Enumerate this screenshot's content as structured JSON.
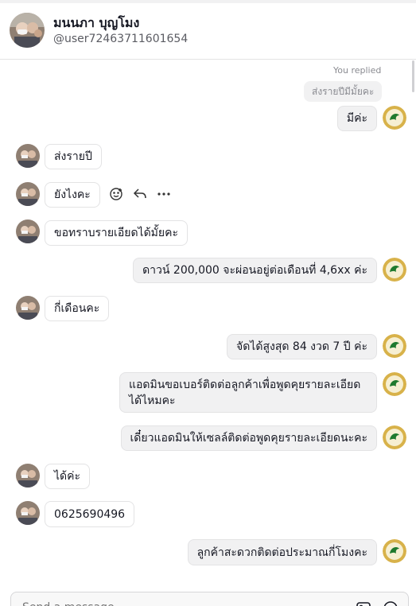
{
  "header": {
    "name": "มนนภา บุญโมง",
    "handle": "@user72463711601654"
  },
  "reply_context": {
    "label": "You replied",
    "quoted_text": "ส่งรายปีมีมั้ยคะ"
  },
  "messages": [
    {
      "from": "me",
      "text": "มีค่ะ"
    },
    {
      "from": "them",
      "text": "ส่งรายปี"
    },
    {
      "from": "them",
      "text": "ยังไงคะ"
    },
    {
      "from": "them",
      "text": "ขอทราบรายเอียดได้มั้ยคะ"
    },
    {
      "from": "me",
      "text": "ดาวน์ 200,000 จะผ่อนอยู่ต่อเดือนที่ 4,6xx ค่ะ"
    },
    {
      "from": "them",
      "text": "กี่เดือนคะ"
    },
    {
      "from": "me",
      "text": "จัดได้สูงสุด 84 งวด 7 ปี ค่ะ"
    },
    {
      "from": "me",
      "text": "แอดมินขอเบอร์ติดต่อลูกค้าเพื่อพูดคุยรายละเอียดได้ไหมคะ"
    },
    {
      "from": "me",
      "text": "เดี๋ยวแอดมินให้เซลล์ติดต่อพูดคุยรายละเอียดนะคะ"
    },
    {
      "from": "them",
      "text": "ได้ค่ะ"
    },
    {
      "from": "them",
      "text": "0625690496"
    },
    {
      "from": "me",
      "text": "ลูกค้าสะดวกติดต่อประมาณกี่โมงคะ"
    }
  ],
  "composer": {
    "placeholder": "Send a message..."
  },
  "colors": {
    "accent_logo_green": "#1f7a2e",
    "logo_gold": "#d8b24a",
    "bubble_out_bg": "#f1f1f2",
    "border": "#e3e3e4"
  },
  "icons": [
    "emoji-icon",
    "reply-icon",
    "more-icon",
    "image-icon",
    "emoji-picker-icon"
  ]
}
